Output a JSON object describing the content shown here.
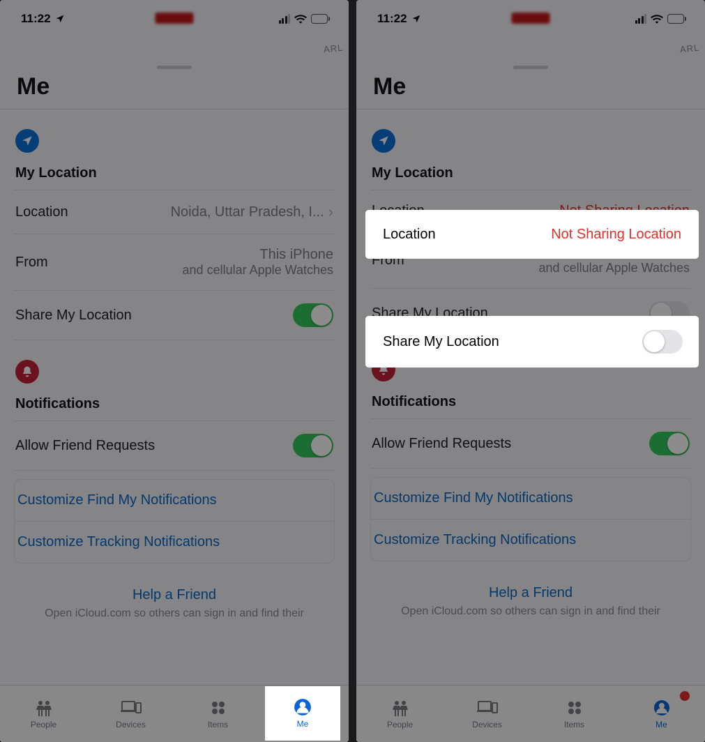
{
  "status": {
    "time": "11:22"
  },
  "sheet": {
    "title": "Me"
  },
  "location_section": {
    "header": "My Location",
    "location_label": "Location",
    "from_label": "From",
    "from_value": "This iPhone",
    "from_sub": "and cellular Apple Watches",
    "share_label": "Share My Location"
  },
  "left": {
    "location_value": "Noida, Uttar Pradesh, I...",
    "share_on": true
  },
  "right": {
    "location_value": "Not Sharing Location",
    "share_on": false
  },
  "notifications_section": {
    "header": "Notifications",
    "allow_label": "Allow Friend Requests",
    "allow_on": true,
    "customize_findmy": "Customize Find My Notifications",
    "customize_tracking": "Customize Tracking Notifications"
  },
  "help": {
    "title": "Help a Friend",
    "sub": "Open iCloud.com so others can sign in and find their"
  },
  "tabs": {
    "people": "People",
    "devices": "Devices",
    "items": "Items",
    "me": "Me"
  }
}
